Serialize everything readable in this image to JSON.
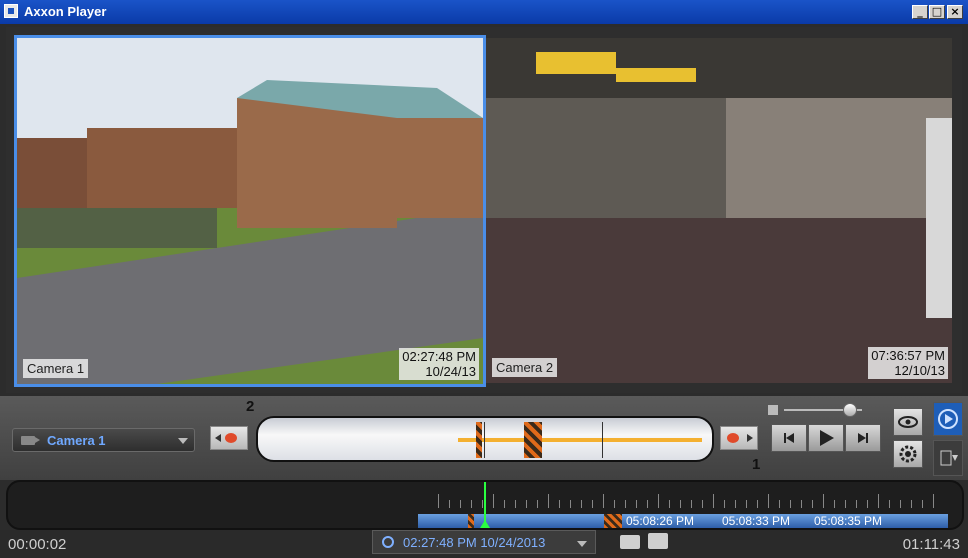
{
  "window": {
    "title": "Axxon Player",
    "min_glyph": "_",
    "max_glyph": "□",
    "close_glyph": "×"
  },
  "cameras": [
    {
      "label": "Camera 1",
      "time": "02:27:48 PM",
      "date": "10/24/13"
    },
    {
      "label": "Camera 2",
      "time": "07:36:57 PM",
      "date": "12/10/13"
    }
  ],
  "controls": {
    "camera_select": "Camera 1",
    "annotation_1": "1",
    "annotation_2": "2",
    "volume_fraction": 0.85
  },
  "timeline": {
    "segments": [
      "05:08:26 PM",
      "05:08:33 PM",
      "05:08:35 PM"
    ]
  },
  "status": {
    "elapsed": "00:00:02",
    "current_datetime": "02:27:48 PM 10/24/2013",
    "total": "01:11:43"
  },
  "colors": {
    "accent": "#4a8ee8",
    "timeline_cursor": "#2aff40",
    "track": "#f4b030"
  },
  "icons": [
    "camera-icon",
    "record-icon",
    "speaker-icon",
    "eye-icon",
    "gear-icon",
    "play-icon",
    "export-icon",
    "clock-icon",
    "snapshot-icon",
    "print-icon"
  ]
}
